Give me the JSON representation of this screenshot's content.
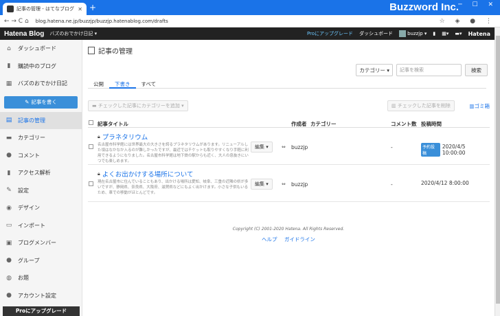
{
  "browser": {
    "tab_title": "記事の管理 - はてなブログ",
    "tab_close": "✕",
    "new_tab": "+",
    "url": "blog.hatena.ne.jp/buzzjp/buzzjp.hatenablog.com/drafts",
    "brand": "Buzzword Inc.",
    "nav_icons": "← → C ⌂",
    "right_icons": "☆ ◈ ● ⋮",
    "window_controls": "─ ☐ ✕"
  },
  "hatena_bar": {
    "logo": "Hatena Blog",
    "blog_selector": "バズのおでかけ日記 ▾",
    "pro_link": "Proにアップグレード",
    "dashboard": "ダッシュボード",
    "user": "buzzjp ▾",
    "hatena": "Hatena"
  },
  "sidebar": {
    "items": [
      {
        "label": "ダッシュボード",
        "icon": "⌂"
      },
      {
        "label": "購読中のブログ",
        "icon": "▮"
      },
      {
        "label": "バズのおでかけ日記",
        "icon": "▦"
      }
    ],
    "write_button": "記事を書く",
    "menu": [
      {
        "label": "記事の管理",
        "icon": "▤",
        "active": true
      },
      {
        "label": "カテゴリー",
        "icon": "▬"
      },
      {
        "label": "コメント",
        "icon": "●"
      },
      {
        "label": "アクセス解析",
        "icon": "▮"
      },
      {
        "label": "設定",
        "icon": "✎"
      },
      {
        "label": "デザイン",
        "icon": "◉"
      },
      {
        "label": "インポート",
        "icon": "▭"
      },
      {
        "label": "ブログメンバー",
        "icon": "▣"
      },
      {
        "label": "グループ",
        "icon": "●"
      },
      {
        "label": "お題",
        "icon": "◍"
      },
      {
        "label": "アカウント設定",
        "icon": "●"
      }
    ],
    "pro_footer": "Proにアップグレード"
  },
  "main": {
    "title": "記事の管理",
    "category_select": "カテゴリー ▾",
    "search_placeholder": "記事を検索",
    "search_button": "検索",
    "tabs": [
      {
        "label": "公開",
        "active": false
      },
      {
        "label": "下書き",
        "active": true
      },
      {
        "label": "すべて",
        "active": false
      }
    ],
    "add_category_button": "▬ チェックした記事にカテゴリーを追加 ▾",
    "delete_button": "▥ チェックした記事を削除",
    "trash_link": "▥ゴミ箱",
    "columns": {
      "title": "記事タイトル",
      "author": "作成者",
      "category": "カテゴリー",
      "comments": "コメント数",
      "posted": "投稿時間"
    },
    "rows": [
      {
        "title": "プラネタリウム",
        "desc": "名古屋市科学館には世界最大の大きさを誇るプラネタリウムがあります。リニューアルした頃はなかなか入るのが難しかったですが、最近ではチケットも取りやすくなり手軽に利用できるようになりました。名古屋市科学館は地下鉄の駅からも近く、大人の息抜きにいつでも楽しめます。",
        "edit": "編集 ▾",
        "link_icon": "⇔",
        "author": "buzzjp",
        "comments": "-",
        "badge": "予約投稿",
        "posted": "2020/4/5 10:00:00"
      },
      {
        "title": "よくお出かけする場所について",
        "desc": "現在名古屋市に住んでいることもあり、出かける場所は愛知、岐阜、三重の近隣の県が多いですが、静岡県、奈良県、大阪府、滋賀県などにもよく出かけます。小さな子供もいるため、車での移動がほとんどです。",
        "edit": "編集 ▾",
        "link_icon": "⇔",
        "author": "buzzjp",
        "comments": "-",
        "badge": "",
        "posted": "2020/4/12 8:00:00"
      }
    ],
    "copyright": "Copyright (C) 2001-2020 Hatena. All Rights Reserved.",
    "help_link": "ヘルプ",
    "guideline_link": "ガイドライン"
  }
}
